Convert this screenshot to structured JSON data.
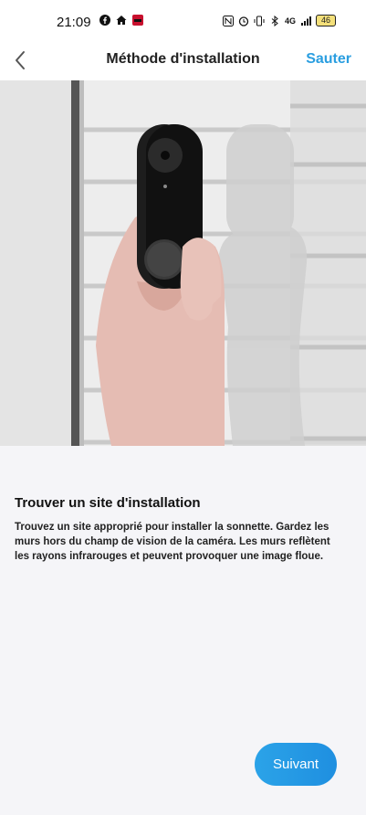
{
  "status_bar": {
    "time": "21:09",
    "battery": "46",
    "signal_text": "4G"
  },
  "header": {
    "title": "Méthode d'installation",
    "skip_label": "Sauter"
  },
  "content": {
    "title": "Trouver un site d'installation",
    "description": "Trouvez un site approprié pour installer la sonnette. Gardez les murs hors du champ de vision de la caméra. Les murs reflètent les rayons infrarouges et peuvent provoquer une image floue."
  },
  "next_button": {
    "label": "Suivant"
  },
  "colors": {
    "accent": "#2a9ee0",
    "button_gradient_start": "#2ba3e8",
    "button_gradient_end": "#1f8fe0",
    "background": "#f5f5f8"
  }
}
